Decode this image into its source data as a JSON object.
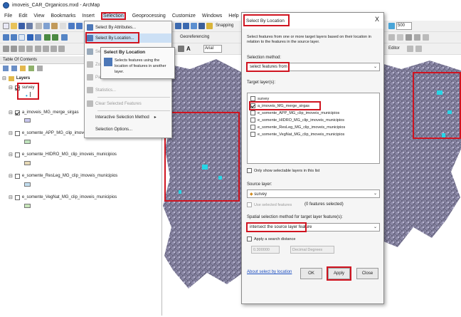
{
  "window": {
    "title": "imoveis_CAR_Organicos.mxd - ArcMap"
  },
  "menu": [
    "File",
    "Edit",
    "View",
    "Bookmarks",
    "Insert",
    "Selection",
    "Geoprocessing",
    "Customize",
    "Windows",
    "Help"
  ],
  "toolbar": {
    "snapping": "Snapping",
    "georeferencing": "Georeferencing",
    "font": "Arial",
    "scale": "500",
    "editor": "Editor"
  },
  "toc": {
    "title": "Table Of Contents",
    "root": "Layers",
    "layers": [
      {
        "name": "survey",
        "checked": true
      },
      {
        "name": "a_imoveis_MG_merge_sirgas",
        "checked": true
      },
      {
        "name": "e_somente_APP_MG_clip_imoveis_municipios",
        "checked": false
      },
      {
        "name": "e_somente_HIDRO_MG_clip_imoveis_municipios",
        "checked": false
      },
      {
        "name": "e_somente_ResLeg_MG_clip_imoveis_municipios",
        "checked": false
      },
      {
        "name": "e_somente_VegNat_MG_clip_imoveis_municipios",
        "checked": false
      }
    ]
  },
  "selection_menu": {
    "items": [
      "Select By Attributes...",
      "Select By Location...",
      "Select",
      "Zoom",
      "Pan",
      "Statistics...",
      "Clear Selected Features",
      "Interactive Selection Method",
      "Selection Options..."
    ]
  },
  "tooltip": {
    "title": "Select By Location",
    "body": "Selects features using the location of features in another layer."
  },
  "dialog": {
    "title": "Select By Location",
    "close": "X",
    "description": "Select features from one or more target layers based on their location in relation to the features in the source layer.",
    "method_label": "Selection method:",
    "method_value": "select features from",
    "targets_label": "Target layer(s):",
    "targets": [
      {
        "name": "survey",
        "checked": false
      },
      {
        "name": "a_imoveis_MG_merge_sirgas",
        "checked": true
      },
      {
        "name": "e_somente_APP_MG_clip_imoveis_municipios",
        "checked": false
      },
      {
        "name": "e_somente_HIDRO_MG_clip_imoveis_municipios",
        "checked": false
      },
      {
        "name": "e_somente_ResLeg_MG_clip_imoveis_municipios",
        "checked": false
      },
      {
        "name": "e_somente_VegNat_MG_clip_imoveis_municipios",
        "checked": false
      }
    ],
    "only_selectable": "Only show selectable layers in this list",
    "source_label": "Source layer:",
    "source_value": "survey",
    "use_selected": "Use selected features",
    "features_selected": "(0 features selected)",
    "spatial_label": "Spatial selection method for target layer feature(s):",
    "spatial_value": "intersect the source layer feature",
    "search_distance": "Apply a search distance",
    "distance_value": "0.300000",
    "distance_units": "Decimal Degrees",
    "about_link": "About select by location",
    "ok": "OK",
    "apply": "Apply",
    "close_btn": "Close"
  }
}
